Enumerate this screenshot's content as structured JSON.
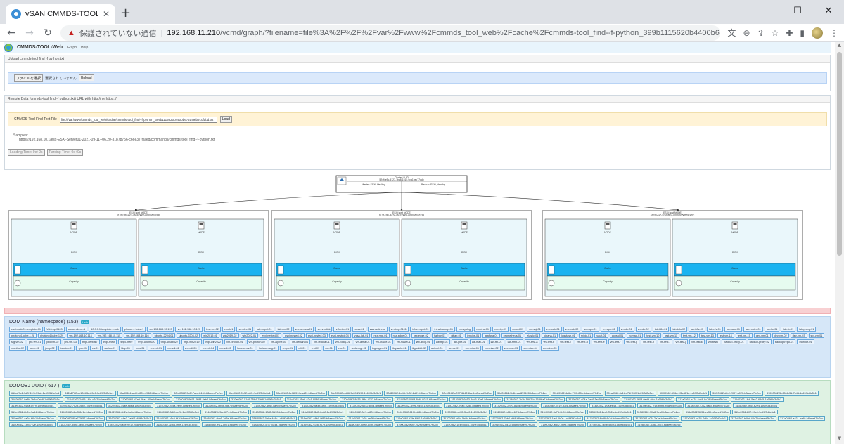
{
  "browser": {
    "tab_title": "vSAN CMMDS-TOOL-Web",
    "window_controls": [
      "—",
      "☐",
      "✕"
    ],
    "insecure_label": "保護されていない通信",
    "url_host": "192.168.11.210",
    "url_path": "/vcmd/graph/?filename=file%3A%2F%2F%2Fvar%2Fwww%2Fcmmds_tool_web%2Fcache%2Fcmmds-tool_find--f-python_399b1115620b4400b672d49fb910fdbd.txt"
  },
  "app": {
    "brand": "CMMDS-TOOL-Web",
    "nav": [
      "Graph",
      "Help"
    ]
  },
  "upload": {
    "heading": "Upload cmmds-tool find -f python.txt",
    "choose_label": "ファイルを選択",
    "no_file": "選択されていません",
    "upload_label": "Upload"
  },
  "remote": {
    "heading": "Remote Data (cmmds-tool find -f python.txt) URL with http:// or https://",
    "field_label": "CMMDS-Tool Find Text File",
    "field_value": "file:///var/www/cmmds_tool_web/cache/cmmds-tool_find--f-python_399b1115620b4400b672d49fb910fdbd.txt",
    "load_label": "Load",
    "samples_label": "Samples:",
    "sample_url": "https://192.168.10.1/esx-ESXi-Server01-2021-09-11--06.20-31878756-c66e37-failed/commands/cmmds-tool_find--f-python.txt",
    "loading_time": "Loading Time: 0e+0s",
    "parsing_time": "Parsing Time: 0e+0s"
  },
  "graph": {
    "cluster": {
      "title": "Cluster UUID",
      "uuid": "524f4e5c-5127-1ba8-1515-9ca1bec77ddb",
      "master": "Master: ESXi, Healthy",
      "backup": "Backup: ESXi, Healthy"
    },
    "hosts": [
      {
        "title": "ESXi host NODE",
        "subtitle": "6131e3fb-aa1f-d6e8-0000-00505691bf36"
      },
      {
        "title": "ESXi host NODE",
        "subtitle": "6131e3fb-3d74-a6e2-0000-005056916234"
      },
      {
        "title": "ESXi host NODE",
        "subtitle": "6131e4a7-7c52-f8ba-0000-0050569c4f2c"
      }
    ],
    "node_label": "NODE",
    "disk_label": "DISK",
    "cache_label": "Cache",
    "capacity_label": "Capacity"
  },
  "domname": {
    "title": "DOM Name (namespace) (153)",
    "badge": "Help",
    "chips": [
      "esxi-node01-template-01",
      "Vol-tmp-0103",
      "crossvolume-1",
      "10.0.0.1 template.vmdk",
      "photon 4 kube-1",
      "vm 192.168.10.113",
      "vm 192.168.10.121",
      "test-vm-02",
      "vmdk-1",
      "vm-dev-01",
      "lab-mgmt-01",
      "lab-vm-02",
      "vm-hc-vasa01",
      "vm-vmdisk",
      "vCenter-01",
      "vcsa-01",
      "vsan-witness",
      "vm-tmp-0101",
      "infra-mgmt-01",
      "infra-backup-01",
      "vm-syslog",
      "vm-dns-01",
      "vm-ntp-01",
      "vm-ad-01",
      "vm-sql-01",
      "vm-web-01",
      "vm-web-02",
      "vm-app-01",
      "vm-app-02",
      "vm-db-01",
      "vm-db-02",
      "lab-k8s-01",
      "lab-k8s-02",
      "lab-k8s-03",
      "lab-nfs-01",
      "lab-iscsi-01",
      "lab-router-01",
      "lab-fw-01",
      "lab-lb-01",
      "lab-proxy-01",
      "photon-4-kube-1.28",
      "photon-4-kube-1.29",
      "vm-192.168.10.114",
      "vm-192.168.10.115",
      "vm-192.168.10.116",
      "ubuntu-2204-01",
      "ubuntu-2204-02",
      "win2019-01",
      "win2019-02",
      "win2022-01",
      "esxi-nested-01",
      "esxi-nested-02",
      "esxi-nested-03",
      "esxi-nested-04",
      "vcsa-lab-01",
      "nsx-mgr-01",
      "nsx-edge-01",
      "nsx-edge-02",
      "harbor-01",
      "gitlab-01",
      "jenkins-01",
      "grafana-01",
      "prometheus-01",
      "elastic-01",
      "kibana-01",
      "logstash-01",
      "minio-01",
      "vault-01",
      "consul-01",
      "nomad-01",
      "test-vm-10",
      "test-vm-11",
      "test-vm-12",
      "test-vm-13",
      "test-vm-14",
      "test-vm-15",
      "dev-vm-01",
      "dev-vm-02",
      "dev-vm-03",
      "stg-vm-01",
      "stg-vm-02",
      "prd-vm-01",
      "prd-vm-02",
      "prd-vm-03",
      "tmpl-centos7",
      "tmpl-rhel8",
      "tmpl-rhel9",
      "tmpl-ubuntu20",
      "tmpl-ubuntu22",
      "tmpl-win2019",
      "tmpl-win2022",
      "vm-photon-01",
      "vm-photon-02",
      "vm-alpine-01",
      "vm-debian-01",
      "vm-fedora-01",
      "vm-rocky-01",
      "vm-alma-01",
      "vm-oracle-01",
      "vm-suse-01",
      "lab-dhcp-01",
      "lab-tftp-01",
      "lab-pxe-01",
      "lab-mail-01",
      "lab-ftp-01",
      "lab-smb-01",
      "vm-test-a",
      "vm-test-b",
      "vm-test-c",
      "vm-test-d",
      "vm-test-e",
      "vm-test-f",
      "vm-test-g",
      "vm-test-h",
      "vm-test-i",
      "vm-test-j",
      "vm-test-k",
      "vm-test-l",
      "backup-proxy-01",
      "backup-proxy-02",
      "backup-repo-01",
      "monitor-01",
      "monitor-02",
      "jump-01",
      "jump-02",
      "bastion-01",
      "vpn-01",
      "ca-01",
      "radius-01",
      "ldap-01",
      "kms-01",
      "vm-vdi-01",
      "vm-vdi-02",
      "vm-vdi-03",
      "vm-vdi-04",
      "vm-vdi-05",
      "horizon-cs-01",
      "horizon-uag-01",
      "vrops-01",
      "vrli-01",
      "vrni-01",
      "vra-01",
      "vro-01",
      "sddc-mgr-01",
      "tkg-mgmt-01",
      "tkg-wkld-01",
      "tkg-wkld-02",
      "avi-ctrl-01",
      "avi-se-01",
      "vm-misc-01",
      "vm-misc-02",
      "vm-misc-03",
      "vm-misc-04",
      "vm-misc-05"
    ]
  },
  "domobj": {
    "title": "DOMOBJ UUID ( 617 )",
    "badge": "Help",
    "chips": [
      "612a27c2-3d2f-11f6-39a6-1c69f3d3c5c1",
      "612a2762-cc13-4f4c-89e6-1c69f3d3c5c1",
      "30a80364-ab6f-d60c-4988-b8aeed7fc2cc",
      "30b40362-9c6f-7aec-b104-b8aeed7fc2cc",
      "30c40162-0b72-a3f1-1c69f3d3c5c1",
      "30c60162-8e08-51fa-ad31-b8aeed7fc2cc",
      "30d00162-dd46-9a39-2d99-1c69f3d3c5c1",
      "30d20162-4e4d-1b32-2d91-b8aeed7fc2cc",
      "30e00162-a077-6142-8ce4-b8aeed7fc2cc",
      "30e20262-3b1b-cad2-9428-b8aeed7fc2cc",
      "30e80362-4e6b-7f00-80fe-b8aeed7fc2cc",
      "30ea0362-4c1b-c71f-95ff-1c69f3d3c5c1",
      "30f00362-536a-9f1c-8f1c-1c69f3d3c5c1",
      "30f20362-d2df-2007-a020-b8aeed7fc2cc",
      "31000362-5e65-4b3d-7b4d-1c69f3d3c5c1",
      "31020362-8e8b-3b4c-0ab8-1c69f3d3c5c1",
      "31040362-2469-1f2d-c7c2-b8aeed7fc2cc",
      "31060362-d7ad-0ba4-90fe-b8aeed7fc2cc",
      "31080362-9071-2b88-8eb2-b8aeed7fc2cc",
      "310a0362-51c9-3564-79b8-1c69f3d3c5c1",
      "310c0362-55a9-a2c1-8036-b8aeed7fc2cc",
      "310e0362-8c35-8f9e-4722-b8aeed7fc2cc",
      "31100362-0063-8b6f-8015-b8aeed7fc2cc",
      "31120362-6e53-4ed6-d3e4-b8aeed7fc2cc",
      "31140362-3b3b-5982-b115-9ba7-b8aeed7fc2cc",
      "31160362-d04a-2ad6-5e45-b8aeed7fc2cc",
      "31180362-2b08-0edd-4fcc-1c69f3d3c5c1",
      "311a0362-ea7c-4c68-9c79-b8aeed7fc2cc",
      "311c0362-1fc6-5ae2-65c5-1c69f3d3c5c1",
      "311e0362-94ba-cb79-1c69f3d3c5c1",
      "31200362-7d28-0c8b-1c69f3d3c5c1",
      "31220362-14ae-a8ea-1c69f3d3c5c1",
      "31240362-2c5a-ee92-b8aeed7fc2cc",
      "31260362-cb08-4db7-b8aeed7fc2cc",
      "31280362-4f8b-0aec-b8aeed7fc2cc",
      "312a0362-6a44-3f0e-1c69f3d3c5c1",
      "312c0362-6932-8f0d-b8aeed7fc2cc",
      "312e0362-3b96-9d4c-1c69f3d3c5c1",
      "31300362-c9a5-02d8-b8aeed7fc2cc",
      "31320362-2b20-81cd-b8aeed7fc2cc",
      "31340362-2c19-d3c8-b8aeed7fc2cc",
      "31360362-1f0a-ee48-1c69f3d3c5c1",
      "31380362-7f14-bbb3-b8aeed7fc2cc",
      "313a0362-f0a2-5ab3-b8aeed7fc2cc",
      "313c0362-cf3d-b2e4-1c69f3d3c5c1",
      "313e0362-8b2e-9a64-b8aeed7fc2cc",
      "31400362-dbd3-8e1c-b8aeed7fc2cc",
      "31420362-6b2a-0a5c-b8aeed7fc2cc",
      "31440362-8dbf-cc2b-1c69f3d3c5c1",
      "31460362-fe5a-5b74-b8aeed7fc2cc",
      "31480362-13d5-5d33-b8aeed7fc2cc",
      "314a0362-f2d5-2c88-1c69f3d3c5c1",
      "314c0362-0ef1-a87d-b8aeed7fc2cc",
      "314e0362-61f8-c88b-b8aeed7fc2cc",
      "31500362-cd95-3ba0-1c69f3d3c5c1",
      "31520362-b86f-d4f7-b8aeed7fc2cc",
      "31540362-3a7d-0b90-b8aeed7fc2cc",
      "31560362-2cdf-7b2a-1c69f3d3c5c1",
      "31580362-90a8-7ea0-b8aeed7fc2cc",
      "315a0362-5b54-ee39-b8aeed7fc2cc",
      "315c0362-2ff7-99c0-1c69f3d3c5c1",
      "315e0362-4a2d-b6c1-b8aeed7fc2cc",
      "31600362-95a7-2b57-b8aeed7fc2cc",
      "31620362-e4e3-7a9f-1c69f3d3c5c1",
      "31640362-a1c5-fd1f-b8aeed7fc2cc",
      "31660362-dda5-3d3e-b8aeed7fc2cc",
      "31680362-0a8a-4c8c-1c69f3d3c5c1",
      "316a0362-e8b0-9f86-b8aeed7fc2cc",
      "316c0362-7c3c-ae7f-b8aeed7fc2cc",
      "316e0362-d7fe-f6b0-1c69f3d3c5c1",
      "31700362-bf2d-5b8b-b8aeed7fc2cc",
      "31720362-7bb4-cbf4-b8aeed7fc2cc",
      "31740362-1fe8-1b0c-1c69f3d3c5c1",
      "31760362-4bd9-4c2d-b8aeed7fc2cc",
      "31780362-c01f-2a1e-b8aeed7fc2cc",
      "317a0362-ce35-7c6d-1c69f3d3c5c1",
      "317c0362-b1bd-48a7-b8aeed7fc2cc",
      "317e0362-aa21-aa59-b8aeed7fc2cc",
      "31800362-13fd-7c2e-1c69f3d3c5c1",
      "31820362-5d8c-ab8d-b8aeed7fc2cc",
      "31840362-0a5e-9212-b8aeed7fc2cc",
      "31860362-ad8a-dfbe-1c69f3d3c5c1",
      "31880362-ef12-8bc1-b8aeed7fc2cc",
      "318a0362-3c77-0a44-b8aeed7fc2cc",
      "318c0362-92dc-f67b-1c69f3d3c5c1",
      "318e0362-b8a9-8c96-b8aeed7fc2cc",
      "31900362-e6f2-2c2f-b8aeed7fc2cc",
      "31920362-1e4b-5cc4-1c69f3d3c5c1",
      "31940362-dd32-6d8b-b8aeed7fc2cc",
      "31960362-a6d2-06e8-b8aeed7fc2cc",
      "31980362-d5fb-53d8-1c69f3d3c5c1",
      "319a0362-a3da-2dc3-b8aeed7fc2cc"
    ]
  },
  "colors": {
    "host_bg": "#eaf7fb",
    "cache_row": "#1ab3f0",
    "capacity_row": "#e6fbef",
    "graph_border": "#333333"
  }
}
